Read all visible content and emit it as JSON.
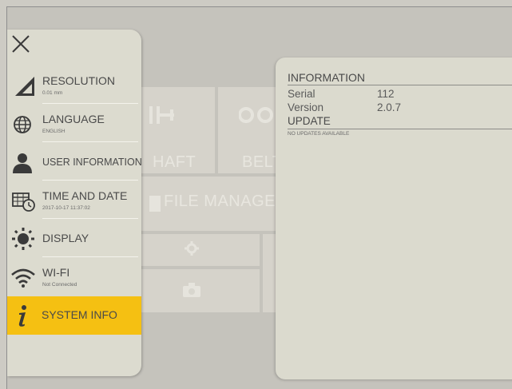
{
  "menu": {
    "close_icon": "close-icon",
    "items": [
      {
        "id": "resolution",
        "label": "RESOLUTION",
        "sub": "0.01 mm",
        "icon": "ruler-triangle-icon"
      },
      {
        "id": "language",
        "label": "LANGUAGE",
        "sub": "ENGLISH",
        "icon": "globe-icon"
      },
      {
        "id": "user-information",
        "label": "USER INFORMATION",
        "sub": "",
        "icon": "user-icon"
      },
      {
        "id": "time-and-date",
        "label": "TIME AND DATE",
        "sub": "2017-10-17 11:37:02",
        "icon": "calendar-clock-icon"
      },
      {
        "id": "display",
        "label": "DISPLAY",
        "sub": "",
        "icon": "sun-icon"
      },
      {
        "id": "wifi",
        "label": "WI-FI",
        "sub": "Not Connected",
        "icon": "wifi-icon"
      },
      {
        "id": "system-info",
        "label": "SYSTEM INFO",
        "sub": "",
        "icon": "info-icon",
        "active": true
      }
    ]
  },
  "background": {
    "tiles": [
      "HAFT",
      "BELT",
      "FILE MANAGE"
    ]
  },
  "info": {
    "information_header": "INFORMATION",
    "serial_label": "Serial",
    "serial_value": "112",
    "version_label": "Version",
    "version_value": "2.0.7",
    "update_header": "UPDATE",
    "update_status": "NO UPDATES AVAILABLE"
  },
  "colors": {
    "accent": "#f5c012",
    "panel": "#dcdbcf",
    "background": "#c5c3bc"
  }
}
